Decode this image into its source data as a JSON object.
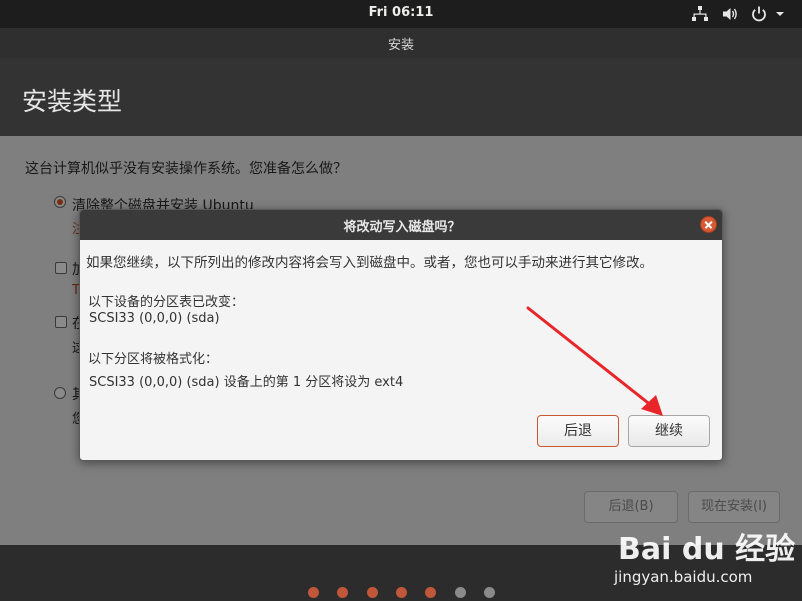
{
  "topbar": {
    "clock": "Fri 06:11"
  },
  "window": {
    "title": "安装",
    "page_title": "安装类型"
  },
  "content": {
    "question": "这台计算机似乎没有安装操作系统。您准备怎么做？",
    "options": [
      {
        "label": "清除整个磁盘并安装 Ubuntu",
        "desc_stub": "注",
        "checked": true
      },
      {
        "label_stub": "加",
        "desc_stub": "T",
        "checked": false
      },
      {
        "label_stub": "在",
        "desc_stub": "这",
        "checked": false
      },
      {
        "label_stub": "其",
        "desc_stub": "您",
        "checked": false
      }
    ],
    "back_button": "后退(B)",
    "install_button": "现在安装(I)"
  },
  "dialog": {
    "title": "将改动写入磁盘吗？",
    "message": "如果您继续，以下所列出的修改内容将会写入到磁盘中。或者，您也可以手动来进行其它修改。",
    "partition_table_heading": "以下设备的分区表已改变：",
    "partition_table_device": "SCSI33 (0,0,0) (sda)",
    "format_heading": "以下分区将被格式化：",
    "format_item": "SCSI33 (0,0,0) (sda) 设备上的第 1 分区将设为 ext4",
    "back_button": "后退",
    "continue_button": "继续"
  },
  "progress": {
    "steps_done": 5,
    "steps_total": 7
  },
  "watermark": {
    "brand": "Bai du 经验",
    "url": "jingyan.baidu.com"
  },
  "colors": {
    "accent": "#c0573b",
    "close_button": "#d85933",
    "annotation_arrow": "#e8262a"
  }
}
